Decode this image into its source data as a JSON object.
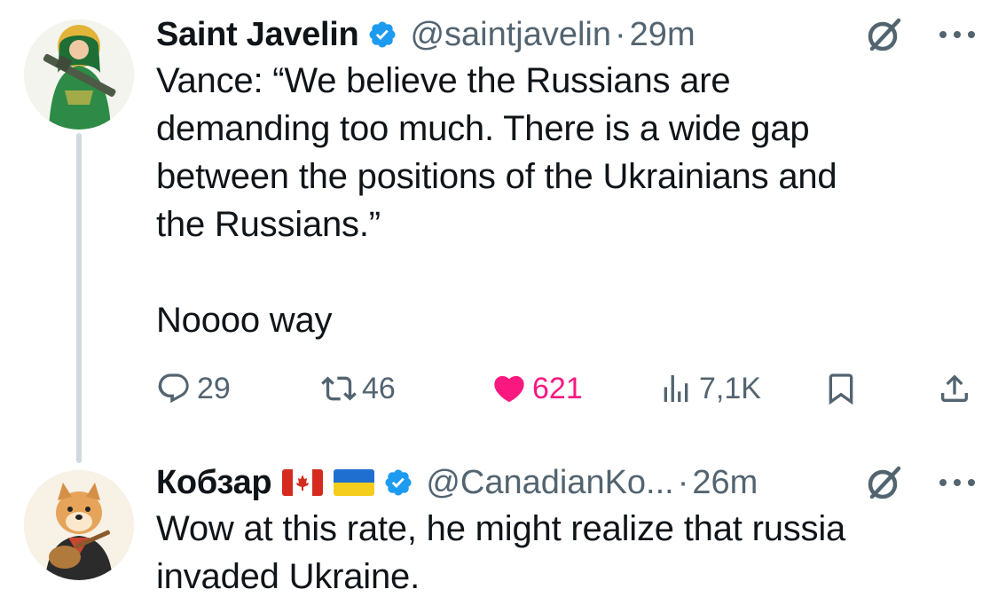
{
  "colors": {
    "text": "#0f1419",
    "secondary": "#536471",
    "verified": "#1d9bf0",
    "like": "#f91880",
    "thread_line": "#cfd9de"
  },
  "tweets": [
    {
      "name": "Saint Javelin",
      "verified": true,
      "handle": "@saintjavelin",
      "separator": "·",
      "time": "29m",
      "text": "Vance: “We believe the Russians are\ndemanding too much. There is a wide gap\nbetween the positions of the Ukrainians and\nthe Russians.”\n\nNoooo way",
      "avatar_icon": "saint-javelin-avatar",
      "actions": {
        "replies": "29",
        "reposts": "46",
        "likes": "621",
        "views": "7,1K"
      }
    },
    {
      "name": "Кобзар",
      "flags": [
        "canada-flag",
        "ukraine-flag"
      ],
      "verified": true,
      "handle": "@CanadianKo...",
      "separator": "·",
      "time": "26m",
      "text": "Wow at this rate, he might realize that russia\ninvaded Ukraine.",
      "avatar_icon": "kobzar-dog-avatar"
    }
  ]
}
